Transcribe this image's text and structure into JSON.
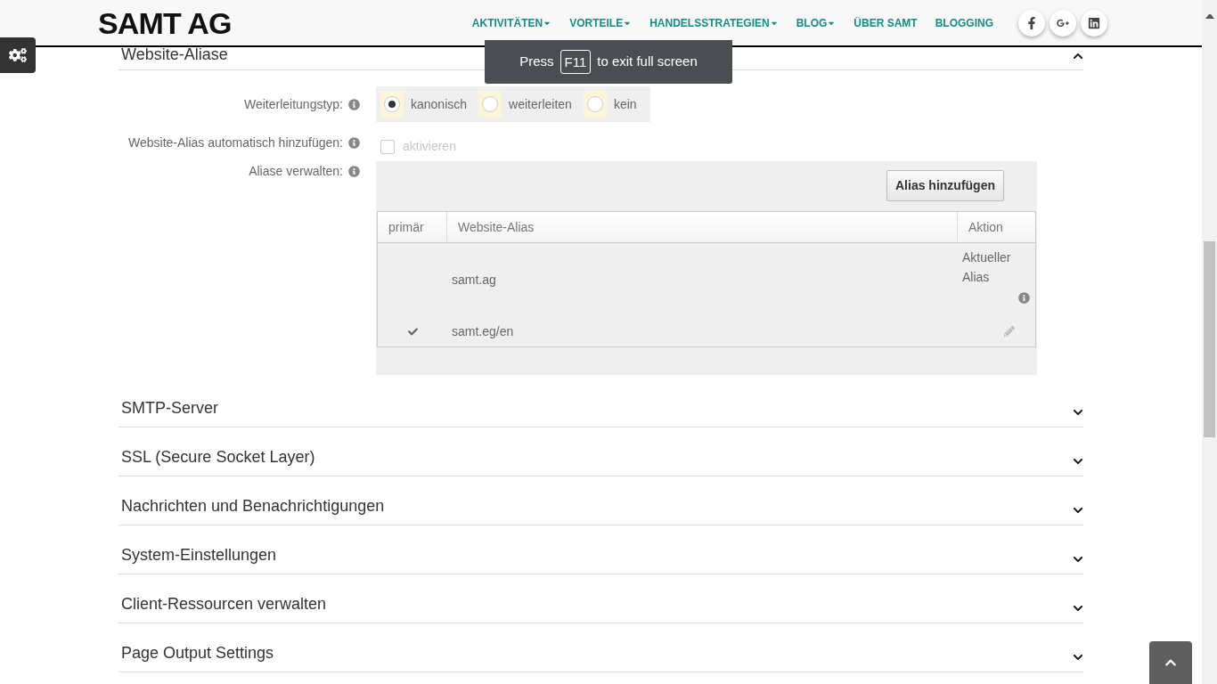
{
  "header": {
    "logo": "SAMT AG",
    "nav": [
      {
        "label": "AKTIVITÄTEN",
        "dropdown": true
      },
      {
        "label": "VORTEILE",
        "dropdown": true
      },
      {
        "label": "HANDELSSTRATEGIEN",
        "dropdown": true
      },
      {
        "label": "BLOG",
        "dropdown": true
      },
      {
        "label": "ÜBER SAMT",
        "dropdown": false
      },
      {
        "label": "BLOGGING",
        "dropdown": false
      }
    ],
    "social": [
      {
        "kind": "facebook"
      },
      {
        "kind": "googleplus"
      },
      {
        "kind": "linkedin"
      }
    ]
  },
  "toast": {
    "before": "Press",
    "key": "F11",
    "after": "to exit full screen"
  },
  "sections": [
    {
      "title": "Website-Aliase",
      "expanded": true
    },
    {
      "title": "SMTP-Server",
      "expanded": false
    },
    {
      "title": "SSL (Secure Socket Layer)",
      "expanded": false
    },
    {
      "title": "Nachrichten und Benachrichtigungen",
      "expanded": false
    },
    {
      "title": "System-Einstellungen",
      "expanded": false
    },
    {
      "title": "Client-Ressourcen verwalten",
      "expanded": false
    },
    {
      "title": "Page Output Settings",
      "expanded": false
    }
  ],
  "form": {
    "redirect_type": {
      "label": "Weiterleitungstyp:",
      "options": [
        {
          "label": "kanonisch",
          "selected": true
        },
        {
          "label": "weiterleiten",
          "selected": false
        },
        {
          "label": "kein",
          "selected": false
        }
      ]
    },
    "auto_add": {
      "label": "Website-Alias automatisch hinzufügen:",
      "option": "aktivieren",
      "checked": false,
      "disabled": true
    },
    "aliases": {
      "label": "Aliase verwalten:",
      "add_button": "Alias hinzufügen",
      "columns": [
        "primär",
        "Website-Alias",
        "Aktion"
      ],
      "rows": [
        {
          "kind": "current",
          "alias": "samt.ag",
          "primary": false,
          "action": "Aktueller Alias"
        },
        {
          "kind": "editable",
          "alias": "samt.eg/en",
          "primary": true
        }
      ]
    }
  }
}
